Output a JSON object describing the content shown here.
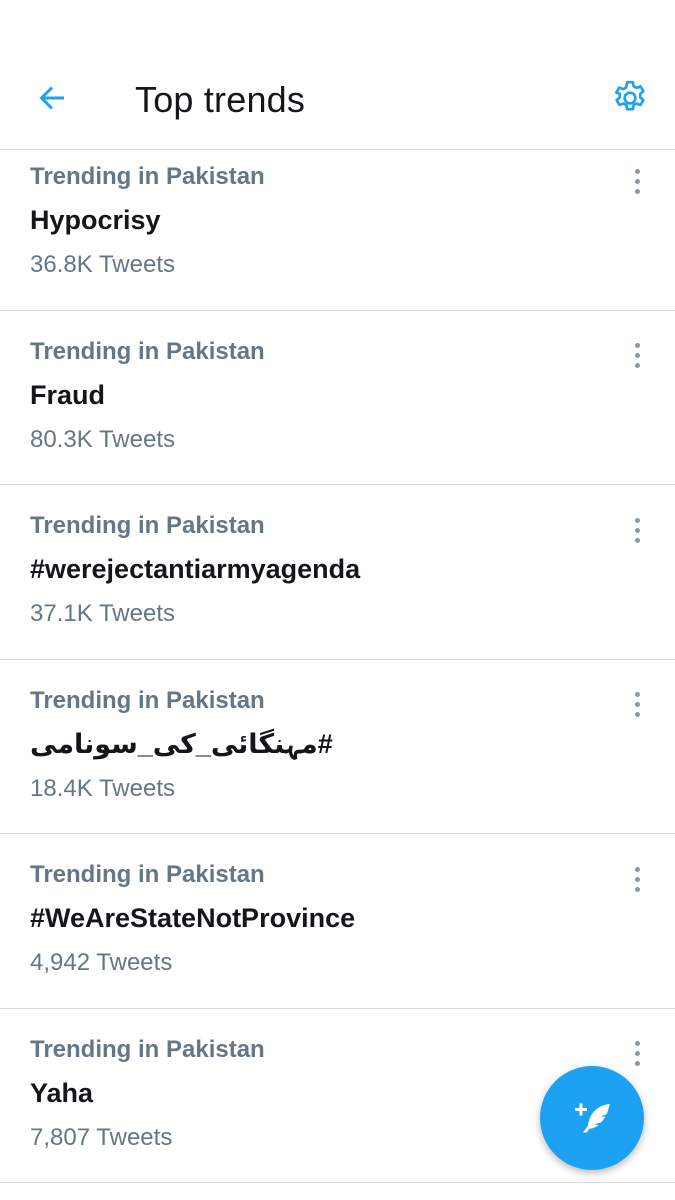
{
  "header": {
    "title": "Top trends",
    "back_icon": "back-arrow-icon",
    "settings_icon": "gear-icon"
  },
  "colors": {
    "accent": "#1da1f2",
    "secondary_text": "#657786",
    "primary_text": "#14171a",
    "divider": "#d4d9dd"
  },
  "trends": [
    {
      "context": "Trending in Pakistan",
      "name": "Hypocrisy",
      "count": "36.8K Tweets"
    },
    {
      "context": "Trending in Pakistan",
      "name": "Fraud",
      "count": "80.3K Tweets"
    },
    {
      "context": "Trending in Pakistan",
      "name": "#werejectantiarmyagenda",
      "count": "37.1K Tweets"
    },
    {
      "context": "Trending in Pakistan",
      "name": "#مہنگائی_کی_سونامی",
      "count": "18.4K Tweets"
    },
    {
      "context": "Trending in Pakistan",
      "name": "#WeAreStateNotProvince",
      "count": "4,942 Tweets"
    },
    {
      "context": "Trending in Pakistan",
      "name": "Yaha",
      "count": "7,807 Tweets"
    }
  ],
  "fab": {
    "icon": "compose-tweet-icon"
  }
}
